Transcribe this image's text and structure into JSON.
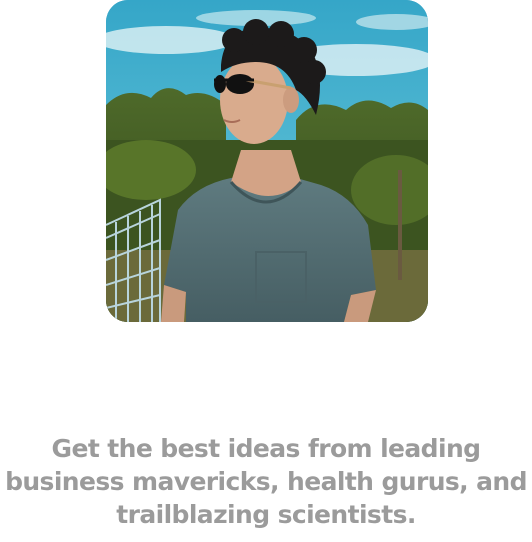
{
  "onboarding": {
    "photo": {
      "description_icon": "portrait-photo"
    },
    "tagline": {
      "line1": "Get the best ideas from leading",
      "line2": "business mavericks, health gurus, and",
      "line3": "trailblazing scientists."
    },
    "colors": {
      "text": "#9b9b9b",
      "background": "#ffffff"
    }
  }
}
